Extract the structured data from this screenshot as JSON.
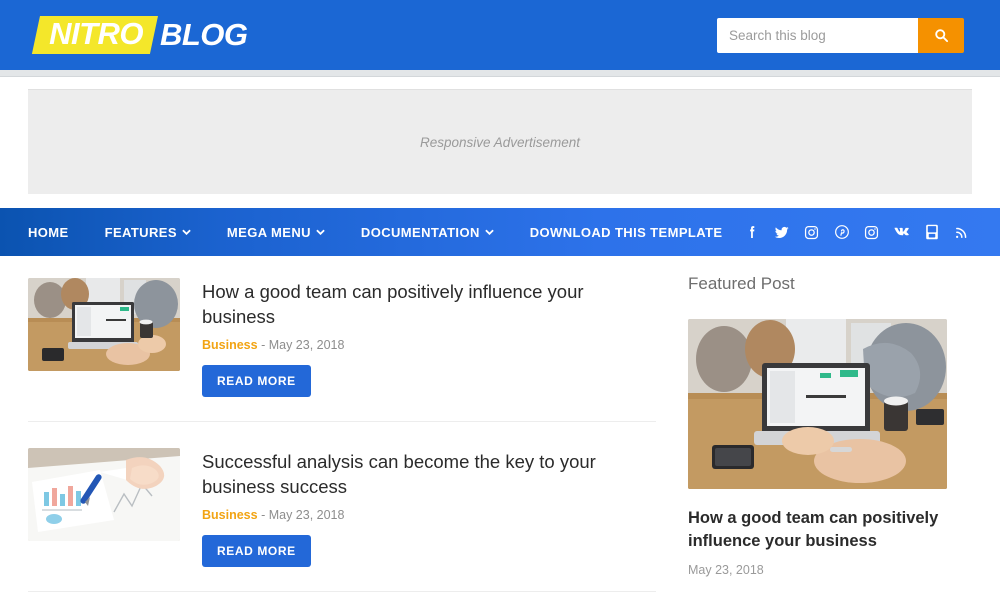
{
  "header": {
    "logo_primary": "NITRO",
    "logo_secondary": "BLOG",
    "logo_bg_color": "#f4e72a",
    "bar_color": "#1b67d4",
    "search": {
      "placeholder": "Search this blog",
      "value": "",
      "button_icon": "search-icon",
      "button_color": "#f59100"
    }
  },
  "advertisement": {
    "label": "Responsive Advertisement"
  },
  "nav": {
    "items": [
      {
        "label": "HOME",
        "has_dropdown": false
      },
      {
        "label": "FEATURES",
        "has_dropdown": true
      },
      {
        "label": "MEGA MENU",
        "has_dropdown": true
      },
      {
        "label": "DOCUMENTATION",
        "has_dropdown": true
      },
      {
        "label": "DOWNLOAD THIS TEMPLATE",
        "has_dropdown": false
      }
    ],
    "caret_glyph": "⌄",
    "social": [
      {
        "name": "facebook-icon"
      },
      {
        "name": "twitter-icon"
      },
      {
        "name": "instagram-icon"
      },
      {
        "name": "pinterest-icon"
      },
      {
        "name": "instagram-icon"
      },
      {
        "name": "vk-icon"
      },
      {
        "name": "youtube-icon"
      },
      {
        "name": "rss-icon"
      }
    ]
  },
  "posts": [
    {
      "title": "How a good team can positively influence your business",
      "category": "Business",
      "date_separator": " - ",
      "date": "May 23, 2018",
      "read_more": "READ MORE",
      "thumbnail_alt": "people working on laptop at table"
    },
    {
      "title": "Successful analysis can become the key to your business success",
      "category": "Business",
      "date_separator": " - ",
      "date": "May 23, 2018",
      "read_more": "READ MORE",
      "thumbnail_alt": "hand holding blue pen over chart papers"
    }
  ],
  "sidebar": {
    "featured": {
      "widget_title": "Featured Post",
      "title": "How a good team can positively influence your business",
      "date": "May 23, 2018",
      "thumbnail_alt": "people working on laptop at table"
    }
  },
  "colors": {
    "brand_blue": "#1b67d4",
    "nav_blue_dark": "#0b53b0",
    "nav_blue_light": "#3479f0",
    "accent_orange": "#f59100",
    "category_amber": "#f2a414",
    "button_blue": "#2368d8"
  }
}
